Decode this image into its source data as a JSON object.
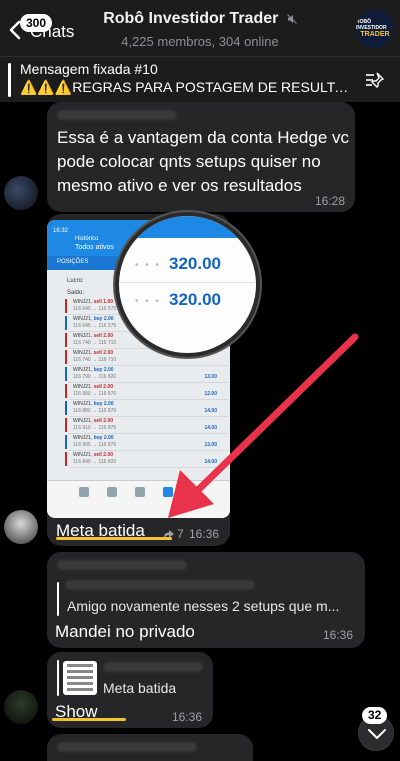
{
  "header": {
    "back_badge": "300",
    "back_label": "Chats",
    "title": "Robô Investidor Trader",
    "subtitle": "4,225 membros, 304 online",
    "avatar_line1": "ROBÔ INVESTIDOR",
    "avatar_line2": "TRADER"
  },
  "pinned": {
    "title": "Mensagem fixada #10",
    "text": "⚠️⚠️⚠️REGRAS PARA POSTAGEM DE RESULTA..."
  },
  "messages": {
    "m1": {
      "text": "Essa é a vantagem da conta Hedge vc pode colocar qnts setups quiser no mesmo ativo e ver os resultados",
      "time": "16:28"
    },
    "m2": {
      "caption": "Meta batida",
      "forwards": "7",
      "time": "16:36",
      "screenshot": {
        "header_title": "Histórico",
        "header_sub": "Todos ativos",
        "tab": "POSIÇÕES",
        "lucro": "Lucro:",
        "saldo": "Saldo:",
        "zoom_value_1": "320.00",
        "zoom_value_2": "320.00",
        "rows": [
          {
            "sym": "WINJ21,",
            "side": "sell 1.00",
            "sell": true,
            "prices": "116 640 → 116 575",
            "res": ""
          },
          {
            "sym": "WINJ21,",
            "side": "buy 2.00",
            "sell": false,
            "prices": "116 645 → 116 575",
            "res": ""
          },
          {
            "sym": "WINJ21,",
            "side": "sell 2.00",
            "sell": true,
            "prices": "116 740 → 116 710",
            "res": ""
          },
          {
            "sym": "WINJ21,",
            "side": "sell 2.00",
            "sell": true,
            "prices": "116 740 → 116 710",
            "res": ""
          },
          {
            "sym": "WINJ21,",
            "side": "buy 2.00",
            "sell": false,
            "prices": "116 790 → 116 820",
            "res": "13.00"
          },
          {
            "sym": "WINJ21,",
            "side": "sell 2.00",
            "sell": true,
            "prices": "116 900 → 116 870",
            "res": "12.00"
          },
          {
            "sym": "WINJ21,",
            "side": "buy 2.00",
            "sell": false,
            "prices": "116 880 → 116 870",
            "res": "14.00"
          },
          {
            "sym": "WINJ21,",
            "side": "sell 2.00",
            "sell": true,
            "prices": "116 910 → 116 875",
            "res": "14.00"
          },
          {
            "sym": "WINJ21,",
            "side": "buy 2.00",
            "sell": false,
            "prices": "116 905 → 116 875",
            "res": "13.00"
          },
          {
            "sym": "WINJ21,",
            "side": "sell 2.00",
            "sell": true,
            "prices": "116 840 → 116 820",
            "res": "14.00"
          }
        ]
      }
    },
    "m3": {
      "reply_text": "Amigo novamente nesses 2 setups que m...",
      "text": "Mandei no privado",
      "time": "16:36"
    },
    "m4": {
      "reply_text": "Meta batida",
      "text": "Show",
      "time": "16:36"
    }
  },
  "scroll": {
    "badge": "32"
  },
  "colors": {
    "accent_underline": "#f4c430",
    "arrow": "#e8334a",
    "bubble": "#262628"
  }
}
